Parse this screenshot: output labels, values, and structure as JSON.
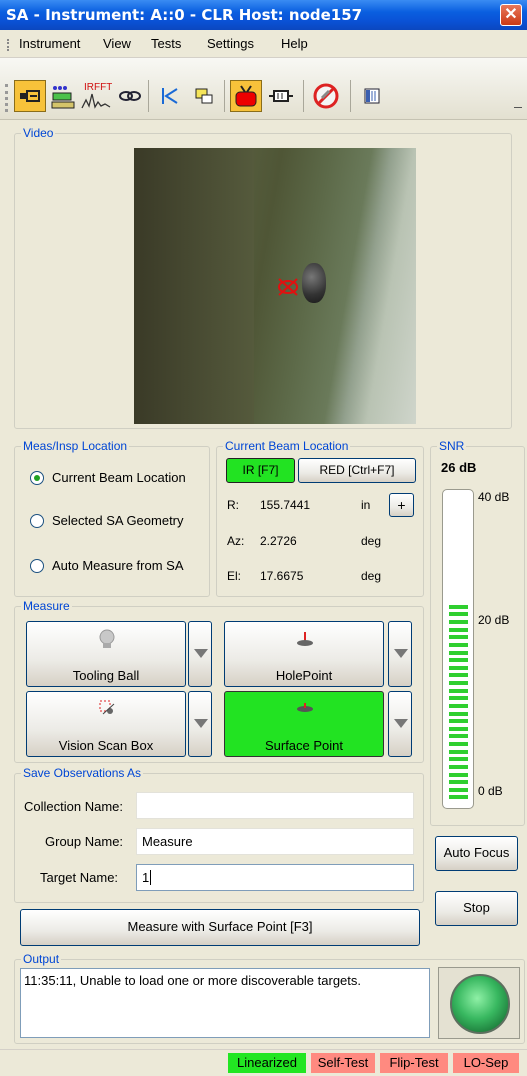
{
  "window": {
    "title": "SA - Instrument: A::0 - CLR Host: node157",
    "close_glyph": "✕"
  },
  "menu": [
    "Instrument",
    "View",
    "Tests",
    "Settings",
    "Help"
  ],
  "toolbar": {
    "buttons": [
      "plug-icon",
      "instrument-config-icon",
      "irfft-icon",
      "link-icon",
      "back-to-home-icon",
      "window-icon",
      "video-camera-icon",
      "probe-icon",
      "stop-icon",
      "panel-icon"
    ],
    "irfft_text": "IRFFT"
  },
  "video": {
    "title": "Video"
  },
  "meas_location": {
    "title": "Meas/Insp Location",
    "options": [
      "Current Beam Location",
      "Selected SA Geometry",
      "Auto Measure from SA"
    ],
    "selected": "Current Beam Location"
  },
  "beam": {
    "title": "Current Beam Location",
    "ir_label": "IR [F7]",
    "red_label": "RED [Ctrl+F7]",
    "r_label": "R:",
    "r_value": "155.7441",
    "r_unit": "in",
    "plus_label": "+",
    "az_label": "Az:",
    "az_value": "2.2726",
    "az_unit": "deg",
    "el_label": "El:",
    "el_value": "17.6675",
    "el_unit": "deg"
  },
  "snr": {
    "title": "SNR",
    "value": "26 dB",
    "top_label": "40 dB",
    "mid_label": "20 dB",
    "bottom_label": "0 dB",
    "level_fraction": 0.65
  },
  "measure": {
    "title": "Measure",
    "tooling_ball": "Tooling Ball",
    "hole_point": "HolePoint",
    "vision_scan": "Vision Scan Box",
    "surface_point": "Surface Point"
  },
  "save": {
    "title": "Save Observations As",
    "collection_label": "Collection Name:",
    "collection_value": "",
    "group_label": "Group Name:",
    "group_value": "Measure",
    "target_label": "Target Name:",
    "target_value": "1"
  },
  "buttons": {
    "auto_focus": "Auto Focus",
    "stop": "Stop",
    "measure_with": "Measure with Surface Point [F3]"
  },
  "output": {
    "title": "Output",
    "text": "11:35:11, Unable to load one or more discoverable targets."
  },
  "status": [
    {
      "label": "Linearized",
      "color": "#22e622"
    },
    {
      "label": "Self-Test",
      "color": "#ff8a80"
    },
    {
      "label": "Flip-Test",
      "color": "#ff8a80"
    },
    {
      "label": "LO-Sep",
      "color": "#ff8a80"
    }
  ]
}
